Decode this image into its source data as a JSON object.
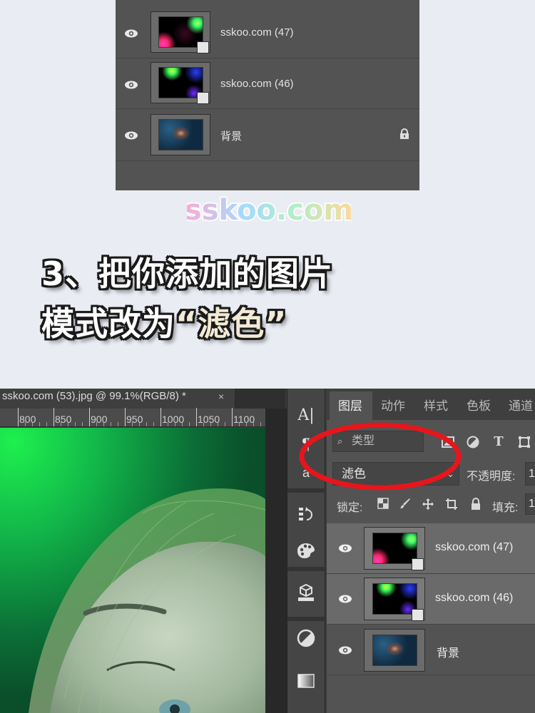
{
  "top_panel": {
    "layers": [
      {
        "name": "sskoo.com (47)",
        "type": "smart-object",
        "visible": true
      },
      {
        "name": "sskoo.com (46)",
        "type": "smart-object",
        "visible": true
      },
      {
        "name": "背景",
        "type": "background",
        "visible": true,
        "locked": true
      }
    ]
  },
  "watermark": "sskoo.com",
  "heading": {
    "line1": "3、把你添加的图片",
    "line2_prefix": "模式改为",
    "line2_highlight": "“滤色”"
  },
  "document": {
    "tab_title": "sskoo.com (53).jpg @ 99.1%(RGB/8) *",
    "close_glyph": "×",
    "ruler_ticks": [
      "800",
      "850",
      "900",
      "950",
      "1000",
      "1050",
      "1100"
    ]
  },
  "toolstrip": {
    "icons": [
      "character-icon",
      "paragraph-icon",
      "glyphs-icon",
      "history-icon",
      "swatches-icon",
      "3d-icon",
      "adjustments-icon",
      "gradient-icon"
    ]
  },
  "layers_panel": {
    "tabs": [
      "图层",
      "动作",
      "样式",
      "色板",
      "通道"
    ],
    "active_tab": "图层",
    "filter_label": "类型",
    "blend_mode": "滤色",
    "opacity_label": "不透明度:",
    "opacity_value": "1",
    "lock_label": "锁定:",
    "fill_label": "填充:",
    "fill_value": "1",
    "layers": [
      {
        "name": "sskoo.com (47)",
        "selected": true
      },
      {
        "name": "sskoo.com (46)",
        "selected": true
      },
      {
        "name": "背景",
        "selected": false
      }
    ]
  },
  "colors": {
    "panel": "#535353",
    "selected_row": "#6a6a6a",
    "annotation": "#e8151c",
    "page_bg": "#e9ecf3"
  }
}
